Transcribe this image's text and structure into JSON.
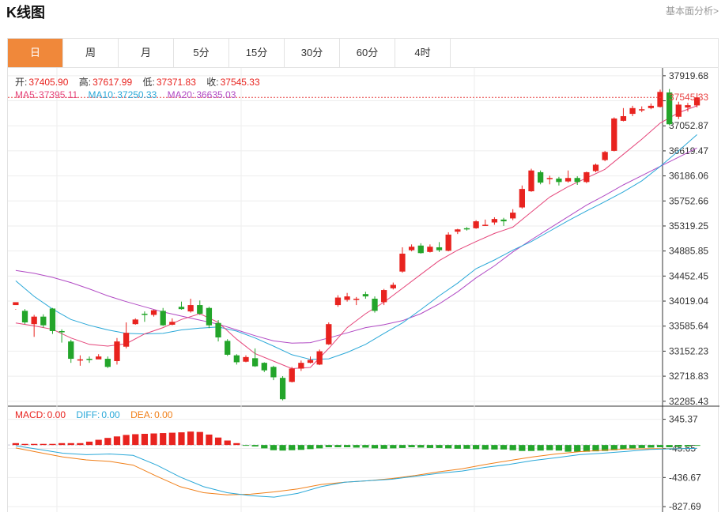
{
  "header": {
    "title": "K线图",
    "link": "基本面分析>"
  },
  "tabs": [
    {
      "label": "日",
      "active": true
    },
    {
      "label": "周",
      "active": false
    },
    {
      "label": "月",
      "active": false
    },
    {
      "label": "5分",
      "active": false
    },
    {
      "label": "15分",
      "active": false
    },
    {
      "label": "30分",
      "active": false
    },
    {
      "label": "60分",
      "active": false
    },
    {
      "label": "4时",
      "active": false
    }
  ],
  "ohlc_info": {
    "open_label": "开:",
    "open": "37405.90",
    "high_label": "高:",
    "high": "37617.99",
    "low_label": "低:",
    "low": "37371.83",
    "close_label": "收:",
    "close": "37545.33"
  },
  "ma_info": {
    "ma5_label": "MA5:",
    "ma5": "37395.11",
    "ma10_label": "MA10:",
    "ma10": "37250.33",
    "ma20_label": "MA20:",
    "ma20": "36635.03"
  },
  "macd_info": {
    "macd_label": "MACD:",
    "macd": "0.00",
    "diff_label": "DIFF:",
    "diff": "0.00",
    "dea_label": "DEA:",
    "dea": "0.00"
  },
  "colors": {
    "up": "#e8231f",
    "down": "#23a52a",
    "ma5": "#e5457a",
    "ma10": "#2aa8d8",
    "ma20": "#b14ac4",
    "dea": "#f07f18",
    "tab_active": "#f0883a",
    "price_line": "#e84545"
  },
  "chart_data": {
    "type": "candlestick",
    "price_axis": {
      "ticks": [
        "37919.68",
        "37486.27",
        "37052.87",
        "36619.47",
        "36186.06",
        "35752.66",
        "35319.25",
        "34885.85",
        "34452.45",
        "34019.04",
        "33585.64",
        "33152.23",
        "32718.83",
        "32285.43"
      ],
      "hidden_ticks": [
        1
      ],
      "ylim": [
        32200,
        38000
      ]
    },
    "last_price": "37545.33",
    "macd_axis": {
      "ticks": [
        "345.37",
        "-45.65",
        "-436.67",
        "-827.69"
      ],
      "ylim": [
        -900,
        500
      ]
    },
    "candles": [
      [
        33950,
        34000,
        33880,
        33870
      ],
      [
        33850,
        33650,
        33880,
        33620
      ],
      [
        33620,
        33750,
        33780,
        33400
      ],
      [
        33750,
        33600,
        33790,
        33560
      ],
      [
        33890,
        33500,
        33900,
        33450
      ],
      [
        33500,
        33480,
        33530,
        33300
      ],
      [
        33320,
        33020,
        33350,
        32950
      ],
      [
        33000,
        33010,
        33080,
        32900
      ],
      [
        33020,
        33010,
        33060,
        32950
      ],
      [
        33010,
        33060,
        33100,
        33020
      ],
      [
        33020,
        32880,
        33060,
        32860
      ],
      [
        32980,
        33320,
        33380,
        32920
      ],
      [
        33230,
        33470,
        33650,
        33200
      ],
      [
        33620,
        33700,
        33720,
        33610
      ],
      [
        33800,
        33780,
        33840,
        33660
      ],
      [
        33780,
        33860,
        33870,
        33750
      ],
      [
        33850,
        33600,
        33900,
        33590
      ],
      [
        33610,
        33660,
        33720,
        33600
      ],
      [
        33920,
        33880,
        34010,
        33870
      ],
      [
        33840,
        33950,
        34060,
        33820
      ],
      [
        33950,
        33800,
        34030,
        33780
      ],
      [
        33900,
        33600,
        33920,
        33550
      ],
      [
        33640,
        33390,
        33690,
        33320
      ],
      [
        33330,
        33090,
        33360,
        33070
      ],
      [
        33080,
        32960,
        33100,
        32920
      ],
      [
        32970,
        33050,
        33080,
        32960
      ],
      [
        33030,
        32890,
        33200,
        32880
      ],
      [
        32950,
        32820,
        32960,
        32790
      ],
      [
        32880,
        32700,
        32900,
        32650
      ],
      [
        32690,
        32320,
        32720,
        32300
      ],
      [
        32620,
        32850,
        32880,
        32610
      ],
      [
        32850,
        32950,
        32990,
        32810
      ],
      [
        32950,
        33000,
        33060,
        32940
      ],
      [
        32920,
        33150,
        33180,
        32910
      ],
      [
        33270,
        33620,
        33650,
        33260
      ],
      [
        33950,
        34080,
        34120,
        33920
      ],
      [
        34040,
        34100,
        34160,
        34010
      ],
      [
        34050,
        34060,
        34090,
        33950
      ],
      [
        34140,
        34100,
        34180,
        34060
      ],
      [
        34060,
        33850,
        34100,
        33820
      ],
      [
        34000,
        34210,
        34230,
        33950
      ],
      [
        34240,
        34300,
        34340,
        34220
      ],
      [
        34530,
        34840,
        34950,
        34510
      ],
      [
        34900,
        34960,
        35000,
        34880
      ],
      [
        34980,
        34850,
        35020,
        34840
      ],
      [
        34870,
        34960,
        35000,
        34860
      ],
      [
        34950,
        34900,
        35040,
        34870
      ],
      [
        34890,
        35170,
        35210,
        34880
      ],
      [
        35220,
        35260,
        35270,
        35180
      ],
      [
        35280,
        35260,
        35300,
        35240
      ],
      [
        35280,
        35400,
        35420,
        35270
      ],
      [
        35340,
        35340,
        35430,
        35320
      ],
      [
        35380,
        35440,
        35470,
        35340
      ],
      [
        35430,
        35400,
        35460,
        35320
      ],
      [
        35450,
        35550,
        35610,
        35420
      ],
      [
        35640,
        35960,
        36020,
        35620
      ],
      [
        35920,
        36280,
        36310,
        35910
      ],
      [
        36250,
        36070,
        36280,
        36040
      ],
      [
        36130,
        36150,
        36190,
        36040
      ],
      [
        36140,
        36080,
        36170,
        36020
      ],
      [
        36090,
        36150,
        36280,
        36070
      ],
      [
        36150,
        36080,
        36180,
        36030
      ],
      [
        36080,
        36250,
        36260,
        36060
      ],
      [
        36270,
        36380,
        36400,
        36250
      ],
      [
        36460,
        36600,
        36620,
        36440
      ],
      [
        36620,
        37180,
        37200,
        36610
      ],
      [
        37140,
        37220,
        37360,
        37130
      ],
      [
        37260,
        37360,
        37400,
        37220
      ],
      [
        37320,
        37340,
        37390,
        37290
      ],
      [
        37360,
        37400,
        37440,
        37340
      ],
      [
        37380,
        37640,
        37680,
        37370
      ],
      [
        37630,
        37080,
        37690,
        37060
      ],
      [
        37210,
        37420,
        37470,
        37170
      ],
      [
        37370,
        37410,
        37450,
        37300
      ],
      [
        37405.9,
        37545.33,
        37617.99,
        37371.83
      ]
    ],
    "ma5": [
      [
        0,
        33640
      ],
      [
        2,
        33590
      ],
      [
        4,
        33530
      ],
      [
        6,
        33380
      ],
      [
        8,
        33270
      ],
      [
        10,
        33240
      ],
      [
        12,
        33280
      ],
      [
        14,
        33450
      ],
      [
        16,
        33560
      ],
      [
        18,
        33700
      ],
      [
        20,
        33800
      ],
      [
        22,
        33650
      ],
      [
        24,
        33360
      ],
      [
        26,
        33110
      ],
      [
        28,
        32980
      ],
      [
        30,
        32850
      ],
      [
        32,
        32870
      ],
      [
        34,
        33200
      ],
      [
        36,
        33560
      ],
      [
        38,
        33800
      ],
      [
        40,
        34000
      ],
      [
        42,
        34240
      ],
      [
        44,
        34480
      ],
      [
        46,
        34720
      ],
      [
        48,
        34900
      ],
      [
        50,
        35050
      ],
      [
        52,
        35190
      ],
      [
        54,
        35300
      ],
      [
        56,
        35560
      ],
      [
        58,
        35820
      ],
      [
        60,
        36000
      ],
      [
        62,
        36150
      ],
      [
        64,
        36300
      ],
      [
        66,
        36560
      ],
      [
        68,
        36820
      ],
      [
        70,
        37100
      ],
      [
        72,
        37280
      ],
      [
        74,
        37400
      ]
    ],
    "ma10": [
      [
        0,
        34370
      ],
      [
        2,
        34100
      ],
      [
        4,
        33880
      ],
      [
        6,
        33700
      ],
      [
        8,
        33600
      ],
      [
        10,
        33520
      ],
      [
        12,
        33460
      ],
      [
        14,
        33450
      ],
      [
        16,
        33460
      ],
      [
        18,
        33520
      ],
      [
        20,
        33550
      ],
      [
        22,
        33570
      ],
      [
        24,
        33500
      ],
      [
        26,
        33380
      ],
      [
        28,
        33240
      ],
      [
        30,
        33090
      ],
      [
        32,
        33010
      ],
      [
        34,
        33020
      ],
      [
        36,
        33130
      ],
      [
        38,
        33270
      ],
      [
        40,
        33460
      ],
      [
        42,
        33640
      ],
      [
        44,
        33870
      ],
      [
        46,
        34110
      ],
      [
        48,
        34330
      ],
      [
        50,
        34580
      ],
      [
        52,
        34730
      ],
      [
        54,
        34900
      ],
      [
        56,
        35050
      ],
      [
        58,
        35230
      ],
      [
        60,
        35410
      ],
      [
        62,
        35580
      ],
      [
        64,
        35740
      ],
      [
        66,
        35910
      ],
      [
        68,
        36100
      ],
      [
        70,
        36350
      ],
      [
        72,
        36620
      ],
      [
        74,
        36900
      ]
    ],
    "ma20": [
      [
        0,
        34550
      ],
      [
        2,
        34500
      ],
      [
        4,
        34430
      ],
      [
        6,
        34340
      ],
      [
        8,
        34230
      ],
      [
        10,
        34110
      ],
      [
        12,
        34010
      ],
      [
        14,
        33920
      ],
      [
        16,
        33830
      ],
      [
        18,
        33760
      ],
      [
        20,
        33690
      ],
      [
        22,
        33620
      ],
      [
        24,
        33520
      ],
      [
        26,
        33420
      ],
      [
        28,
        33330
      ],
      [
        30,
        33290
      ],
      [
        32,
        33300
      ],
      [
        34,
        33380
      ],
      [
        36,
        33470
      ],
      [
        38,
        33560
      ],
      [
        40,
        33610
      ],
      [
        42,
        33680
      ],
      [
        44,
        33800
      ],
      [
        46,
        33970
      ],
      [
        48,
        34180
      ],
      [
        50,
        34420
      ],
      [
        52,
        34630
      ],
      [
        54,
        34870
      ],
      [
        56,
        35080
      ],
      [
        58,
        35280
      ],
      [
        60,
        35480
      ],
      [
        62,
        35680
      ],
      [
        64,
        35850
      ],
      [
        66,
        36030
      ],
      [
        68,
        36190
      ],
      [
        70,
        36350
      ],
      [
        72,
        36510
      ],
      [
        74,
        36670
      ]
    ],
    "macd_hist": [
      25,
      15,
      15,
      15,
      15,
      25,
      25,
      25,
      45,
      70,
      95,
      115,
      135,
      145,
      150,
      155,
      160,
      165,
      170,
      180,
      175,
      140,
      100,
      60,
      25,
      -10,
      -20,
      -45,
      -70,
      -75,
      -70,
      -65,
      -55,
      -45,
      -30,
      -30,
      -30,
      -35,
      -35,
      -45,
      -50,
      -45,
      -40,
      -30,
      -35,
      -40,
      -40,
      -45,
      -50,
      -50,
      -55,
      -60,
      -60,
      -60,
      -70,
      -80,
      -80,
      -75,
      -70,
      -75,
      -90,
      -90,
      -90,
      -85,
      -80,
      -70,
      -55,
      -45,
      -40,
      -35,
      -30,
      -30,
      -25,
      -20,
      -10
    ],
    "diff": [
      [
        0,
        -10
      ],
      [
        4,
        -60
      ],
      [
        8,
        -110
      ],
      [
        12,
        -130
      ],
      [
        16,
        -120
      ],
      [
        20,
        -140
      ],
      [
        24,
        -270
      ],
      [
        28,
        -430
      ],
      [
        32,
        -560
      ],
      [
        36,
        -640
      ],
      [
        40,
        -680
      ],
      [
        44,
        -700
      ],
      [
        48,
        -650
      ],
      [
        52,
        -560
      ],
      [
        56,
        -500
      ],
      [
        60,
        -480
      ],
      [
        64,
        -460
      ],
      [
        68,
        -420
      ],
      [
        72,
        -380
      ],
      [
        76,
        -350
      ],
      [
        80,
        -300
      ],
      [
        84,
        -260
      ],
      [
        88,
        -210
      ],
      [
        92,
        -170
      ],
      [
        96,
        -130
      ],
      [
        100,
        -110
      ],
      [
        104,
        -85
      ],
      [
        108,
        -60
      ],
      [
        112,
        -50
      ],
      [
        116,
        -45
      ]
    ],
    "dea": [
      [
        0,
        -40
      ],
      [
        4,
        -100
      ],
      [
        8,
        -160
      ],
      [
        12,
        -200
      ],
      [
        16,
        -220
      ],
      [
        20,
        -270
      ],
      [
        24,
        -420
      ],
      [
        28,
        -560
      ],
      [
        32,
        -640
      ],
      [
        36,
        -670
      ],
      [
        40,
        -660
      ],
      [
        44,
        -630
      ],
      [
        48,
        -590
      ],
      [
        52,
        -530
      ],
      [
        56,
        -500
      ],
      [
        60,
        -480
      ],
      [
        64,
        -450
      ],
      [
        68,
        -410
      ],
      [
        72,
        -360
      ],
      [
        76,
        -320
      ],
      [
        80,
        -260
      ],
      [
        84,
        -210
      ],
      [
        88,
        -160
      ],
      [
        92,
        -120
      ],
      [
        96,
        -90
      ],
      [
        100,
        -70
      ],
      [
        104,
        -55
      ],
      [
        108,
        -50
      ],
      [
        112,
        -48
      ],
      [
        116,
        -45
      ]
    ]
  }
}
